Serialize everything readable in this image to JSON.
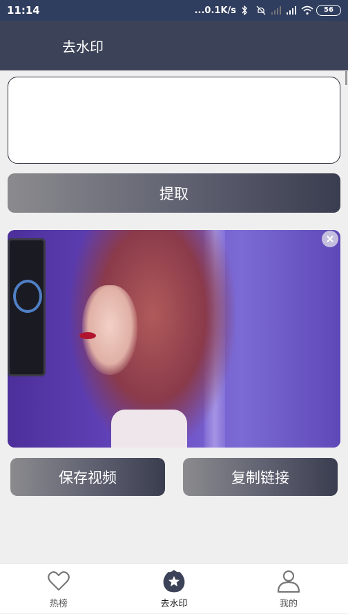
{
  "status_bar": {
    "time": "11:14",
    "network_speed": "...0.1K/s",
    "battery": "56",
    "icons": [
      "bluetooth-icon",
      "mute-icon",
      "signal-icon",
      "signal-icon",
      "wifi-icon",
      "battery-icon"
    ]
  },
  "app_bar": {
    "title": "去水印"
  },
  "input": {
    "value": "",
    "placeholder": ""
  },
  "extract_button": {
    "label": "提取"
  },
  "video": {
    "close_icon": "close-icon"
  },
  "actions": {
    "save_label": "保存视频",
    "copy_label": "复制链接"
  },
  "tabs": [
    {
      "label": "热榜",
      "icon": "heart-icon",
      "active": false
    },
    {
      "label": "去水印",
      "icon": "star-badge-icon",
      "active": true
    },
    {
      "label": "我的",
      "icon": "user-icon",
      "active": false
    }
  ],
  "colors": {
    "status_bar": "#2f3d5e",
    "app_bar": "#3c4257",
    "button_gradient_start": "#8b8b8e",
    "button_gradient_end": "#3a3d4f",
    "background": "#efefef"
  }
}
